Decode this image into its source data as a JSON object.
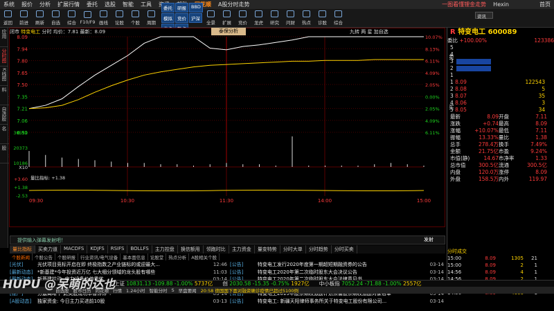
{
  "menu": {
    "items": [
      "系统",
      "报价",
      "分析",
      "扩展行情",
      "委托",
      "选股",
      "智能",
      "工具",
      "资讯",
      "帮助"
    ],
    "brand": "同花顺",
    "center": "A股分时走势",
    "right": "一图看懂锂金走势",
    "app": "Hexin",
    "search": "资讯",
    "home": "首页"
  },
  "toolbar": {
    "items": [
      "返回",
      "前进",
      "刷新",
      "自选",
      "综合",
      "F10/F9",
      "画线",
      "论股",
      "个股",
      "周期",
      "全景",
      "扩展",
      "竞价",
      "龙虎",
      "研究",
      "问财",
      "热点",
      "诊股",
      "综合"
    ],
    "blue": [
      "委托",
      "研报",
      "BBD",
      "模拟",
      "竞价",
      "沪深",
      "龙虎",
      "热点"
    ]
  },
  "leftnav": [
    "应用",
    "分时图",
    "K线图",
    "个股资料",
    "自选股",
    "综合排名",
    "牛叉诊股"
  ],
  "chart": {
    "info": {
      "prefix": "闭市",
      "name": "特变电工",
      "label": "分时 均价：7.81 最新：8.09"
    },
    "fenxi": "泰保分析",
    "links": "九转 两 星 加自选",
    "yTicks": [
      8.09,
      7.94,
      7.8,
      7.65,
      7.5,
      7.35,
      7.21,
      7.06,
      6.92
    ],
    "pctTicks": [
      "10.07%",
      "8.13%",
      "6.11%",
      "4.09%",
      "2.05%",
      "0.00%",
      "2.05%",
      "4.09%",
      "6.11%"
    ],
    "volTicks": [
      30559,
      20373,
      10186
    ],
    "volPct": "X10",
    "macdTicks": [
      "+3.60",
      "+1.38",
      "-2.53"
    ],
    "macdLabel": "量比指标: +1.38",
    "times": [
      "09:30",
      "10:30",
      "11:30",
      "14:00",
      "15:00"
    ]
  },
  "chart_data": {
    "type": "line",
    "series": [
      {
        "name": "price",
        "values": [
          7.21,
          7.25,
          7.33,
          7.48,
          7.62,
          7.74,
          7.86,
          8.01,
          8.09,
          8.09,
          8.09,
          7.95,
          7.93,
          7.97,
          7.99,
          8.02,
          8.05,
          8.09,
          8.09,
          8.09,
          8.09,
          8.09,
          8.09,
          8.09,
          8.09
        ]
      },
      {
        "name": "avg",
        "values": [
          7.21,
          7.22,
          7.25,
          7.32,
          7.41,
          7.49,
          7.56,
          7.62,
          7.66,
          7.69,
          7.72,
          7.74,
          7.75,
          7.76,
          7.77,
          7.78,
          7.79,
          7.79,
          7.8,
          7.8,
          7.8,
          7.81,
          7.81,
          7.81,
          7.81
        ]
      }
    ],
    "ylim": [
      6.92,
      8.09
    ],
    "volume": [
      1.2,
      0.9,
      0.7,
      0.6,
      0.5,
      0.4,
      0.3,
      0.3,
      0.2,
      0.2,
      0.1,
      0.2,
      0.3,
      0.2,
      0.2,
      0.1,
      2.3,
      0.1,
      0.1,
      0.1,
      0.1,
      0.2,
      0.3,
      0.2,
      0.1
    ]
  },
  "quote": {
    "code": "特变电工 600089",
    "weibi": "委比",
    "weibiVal": "+100.00%",
    "weicha": "123386",
    "sellLabel": "卖",
    "buyLabel": "买",
    "levels": [
      "5",
      "4",
      "3",
      "2",
      "1"
    ],
    "buy": [
      {
        "p": "8.09",
        "v": "122543"
      },
      {
        "p": "8.08",
        "v": "5"
      },
      {
        "p": "8.07",
        "v": "35"
      },
      {
        "p": "8.06",
        "v": "3"
      },
      {
        "p": "8.05",
        "v": "34"
      }
    ],
    "rows": [
      [
        "最新",
        "8.09",
        "开盘",
        "7.11"
      ],
      [
        "涨跌",
        "+0.74",
        "最高",
        "8.09"
      ],
      [
        "涨幅",
        "+10.07%",
        "最低",
        "7.11"
      ],
      [
        "振幅",
        "13.33%",
        "量比",
        "1.38"
      ],
      [
        "总手",
        "278.4万",
        "换手",
        "7.49%"
      ],
      [
        "金额",
        "21.75亿",
        "市盈",
        "9.24%"
      ],
      [
        "市值(静)",
        "14.67",
        "市净率",
        "1.33"
      ],
      [
        "总市值",
        "300.5亿",
        "流通",
        "300.5亿"
      ],
      [
        "内盘",
        "120.0万",
        "涨停",
        "8.09"
      ],
      [
        "外盘",
        "158.5万",
        "内外",
        "119.97"
      ]
    ]
  },
  "cmd": {
    "placeholder": "提供输入弹幕发射吧！",
    "send": "发射"
  },
  "tabs": [
    "量比指标",
    "买卖力道",
    "MACDFS",
    "KDJFS",
    "RSIFS",
    "BOLLFS",
    "主力控盘",
    "换信额用",
    "领跑时比",
    "主力资金",
    "量变特势",
    "分时大单",
    "分时趋势",
    "分时买卖"
  ],
  "subtabs": [
    "个股新闻",
    "个股公告",
    "个股研报",
    "行业资讯/电气设备",
    "基本面信息",
    "论股堂",
    "热点分析",
    "A股相关个股"
  ],
  "newsL": [
    {
      "tg": "[光伏]",
      "tx": "光伏项目竞标开启在即 终极指数之产业链标的或迎最大...",
      "tm": "12:46"
    },
    {
      "tg": "[最新动态]",
      "tx": "*新基建*今年投资近万亿 七大细分领域的龙头股有哪些",
      "tm": "11:03"
    },
    {
      "tg": "[最新动态]",
      "tx": "新基建拉动: 电力设备价值重估",
      "tm": "03-14"
    },
    {
      "tg": "[A股学]",
      "tx": "特变电工: 主力机构追踪度动间解读",
      "tm": "03-14"
    },
    {
      "tg": "[推广]",
      "tx": "分震离晰下 此类股成功率香饽饽*!",
      "tm": "03-14"
    },
    {
      "tg": "[A股动态]",
      "tx": "独家资金: 今日主力买进前10股",
      "tm": "03-13"
    }
  ],
  "newsR": [
    {
      "tg": "[公告]",
      "tx": "特变电工发行2020年度第一期超短期融资券的公告",
      "tm": "03-14"
    },
    {
      "tg": "[公告]",
      "tx": "特变电工2020年第二次临时股东大会决议公告",
      "tm": "03-14"
    },
    {
      "tg": "[公告]",
      "tx": "特变电工2020年第二次临时股东大会法律意见书",
      "tm": "03-14"
    },
    {
      "tg": "[公告]",
      "tx": "特变电工关于向激励对象授予2019年股票期权激励计划预留...",
      "tm": "03-14"
    },
    {
      "tg": "[公告]",
      "tx": "特变电工2019年股票期权激励计划预留股票期权激励对象名单",
      "tm": "03-14"
    },
    {
      "tg": "[公告]",
      "tx": "特变电工: 新疆天阳律师事务所关于特变电工股份有限公司...",
      "tm": "03-14"
    }
  ],
  "deals": {
    "title": "分时成交",
    "rows": [
      [
        "15:00",
        "8.09",
        "1305",
        "21"
      ],
      [
        "15:00",
        "8.09",
        "2",
        "1"
      ],
      [
        "14:56",
        "8.09",
        "4",
        "1"
      ],
      [
        "14:56",
        "8.09",
        "2",
        "1"
      ],
      [
        "14:56",
        "8.09",
        "9",
        "1"
      ],
      [
        "14:56",
        "8.09",
        "4606",
        "1"
      ]
    ]
  },
  "status": {
    "items": [
      {
        "n": "上证",
        "v": "10831.13",
        "c": "-109.88",
        "p": "-1.00%",
        "a": "5737亿"
      },
      {
        "n": "创",
        "v": "2030.58",
        "c": "-15.35",
        "p": "-0.75%",
        "a": "1927亿"
      },
      {
        "n": "中小板指",
        "v": "7052.24",
        "c": "-71.88",
        "p": "-1.00%",
        "a": "2557亿"
      }
    ]
  },
  "bottom": {
    "items": [
      "自选股",
      "股市日历",
      "同花顺",
      "行情",
      "1.24小时",
      "智能分时",
      "S",
      "早盘要闻",
      "20:58 德国国下面对融资确诊疫情已超过5100例"
    ]
  },
  "watermark": "HUPU @呆萌的达也"
}
